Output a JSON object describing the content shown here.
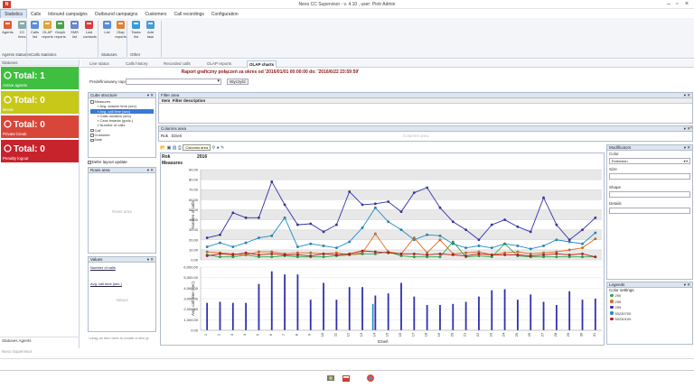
{
  "window": {
    "title": "Nexo CC Supervisor - v. 4.10 , user: Piotr Admin"
  },
  "menu": [
    "Statistics",
    "Calls",
    "Inbound campaigns",
    "Outbound campaigns",
    "Customers",
    "Call recordings",
    "Configuration"
  ],
  "ribbon": {
    "buttons": [
      {
        "label": "Agents",
        "icon": "agents-icon"
      },
      {
        "label": "CC lines",
        "icon": "cc-lines-icon"
      },
      {
        "label": "Calls list",
        "icon": "calls-list-icon"
      },
      {
        "label": "OLAP reports",
        "icon": "olap-reports-icon"
      },
      {
        "label": "Graph reports",
        "icon": "graph-reports-icon"
      },
      {
        "label": "SMS list",
        "icon": "sms-list-icon"
      },
      {
        "label": "Lost contacts",
        "icon": "lost-contacts-icon"
      },
      {
        "label": "List",
        "icon": "list-icon"
      },
      {
        "label": "Olap reports",
        "icon": "olap-reports-2-icon"
      },
      {
        "label": "Tasks list",
        "icon": "tasks-list-icon"
      },
      {
        "label": "Add task",
        "icon": "add-task-icon"
      }
    ],
    "groups": [
      "Agents statuses",
      "Calls statistics",
      "Statuses",
      "Other"
    ]
  },
  "left": {
    "header": "Statuses",
    "tiles": [
      {
        "value": "Total: 1",
        "name": "Active agents",
        "color": "#3fbf3f"
      },
      {
        "value": "Total: 0",
        "name": "Break",
        "color": "#c8c819"
      },
      {
        "value": "Total: 0",
        "name": "Private break",
        "color": "#d8463a"
      },
      {
        "value": "Total: 0",
        "name": "Penalty logout",
        "color": "#c7232d"
      }
    ],
    "bottom_tabs": "Statuses  Agents",
    "footer": "Nexo Supervisor"
  },
  "tabs": [
    "Line status",
    "Calls history",
    "Recorded calls",
    "OLAP reports",
    "OLAP charts"
  ],
  "report": {
    "title": "Raport graficzny połączeń za okres od '2016/01/01 00:00:00 do: '2016/6/22 23:59:59'",
    "predefined_label": "Predefiniowany raport:",
    "clear_button": "Wyczyść"
  },
  "cube": {
    "header": "Cube structure",
    "measures_label": "Measures",
    "items": [
      "Avg. answer time (sec)",
      "Avg. call time (sec)",
      "Calls duration (sec)",
      "Czas trwania (godz.)",
      "Number of calls"
    ],
    "groups": [
      "Call",
      "Customer",
      "Date"
    ]
  },
  "defer_label": "Defer layout update",
  "rows_area": {
    "header": "Rows area",
    "placeholder": "Rows area"
  },
  "values_area": {
    "header": "Values",
    "fields": [
      "Number of calls",
      "Avg. call time (sec.)"
    ],
    "sub": "Values"
  },
  "filter_area": {
    "header": "Filter area",
    "col_item": "Item",
    "col_desc": "Filter description"
  },
  "columns_area": {
    "header": "Columns area",
    "fields": [
      "Rok",
      "Dzień"
    ],
    "placeholder": "Columns area"
  },
  "chart_toolbar": {
    "tooltip": "Columns area"
  },
  "chart_header": {
    "rok": "Rok",
    "year": "2016",
    "measures": "Measures"
  },
  "chart_data": {
    "type": "line",
    "x": [
      1,
      2,
      3,
      4,
      5,
      6,
      7,
      8,
      9,
      10,
      11,
      12,
      13,
      14,
      15,
      16,
      17,
      18,
      19,
      20,
      21,
      22,
      23,
      24,
      25,
      26,
      27,
      28,
      29,
      30,
      31
    ],
    "xlabel": "Dzień",
    "top_panel": {
      "ylabel": "Number of calls",
      "ylim": [
        0,
        90
      ],
      "yticks": [
        "0.00",
        "10.00",
        "20.00",
        "30.00",
        "40.00",
        "50.00",
        "60.00",
        "70.00",
        "80.00",
        "90.00"
      ],
      "series": [
        {
          "color": "#3030b0",
          "values": [
            22,
            25,
            47,
            42,
            42,
            78,
            55,
            35,
            36,
            28,
            35,
            68,
            55,
            56,
            58,
            48,
            67,
            72,
            52,
            38,
            30,
            20,
            35,
            40,
            33,
            28,
            62,
            35,
            20,
            30,
            42
          ]
        },
        {
          "color": "#1c8ec4",
          "values": [
            13,
            17,
            13,
            17,
            22,
            24,
            42,
            13,
            16,
            14,
            12,
            18,
            32,
            52,
            38,
            30,
            20,
            25,
            24,
            16,
            12,
            14,
            12,
            16,
            14,
            11,
            14,
            20,
            18,
            16,
            27
          ]
        },
        {
          "color": "#28a745",
          "values": [
            5,
            3,
            3,
            5,
            3,
            3,
            4,
            3,
            3,
            3,
            4,
            5,
            6,
            6,
            8,
            4,
            3,
            3,
            3,
            18,
            3,
            4,
            3,
            16,
            4,
            3,
            3,
            3,
            3,
            3,
            3
          ]
        },
        {
          "color": "#e36b17",
          "values": [
            8,
            7,
            6,
            5,
            8,
            8,
            6,
            7,
            7,
            6,
            7,
            5,
            7,
            26,
            8,
            6,
            22,
            7,
            20,
            6,
            7,
            8,
            5,
            7,
            8,
            6,
            7,
            8,
            10,
            12,
            21
          ]
        },
        {
          "color": "#c01818",
          "values": [
            4,
            6,
            5,
            7,
            5,
            6,
            5,
            5,
            4,
            6,
            5,
            6,
            9,
            8,
            7,
            6,
            6,
            5,
            6,
            5,
            4,
            6,
            5,
            5,
            5,
            4,
            5,
            6,
            5,
            6,
            3
          ]
        }
      ]
    },
    "bottom_panel": {
      "ylabel": "Avg. call time (sec)",
      "ylim": [
        0,
        6000
      ],
      "yticks": [
        "0.00",
        "1,000.00",
        "2,000.00",
        "3,000.00",
        "4,000.00",
        "5,000.00",
        "6,000.00"
      ],
      "bars": [
        2600,
        2700,
        2600,
        2600,
        4400,
        5600,
        5300,
        5300,
        2900,
        4500,
        2900,
        4100,
        4100,
        3300,
        3500,
        4500,
        3200,
        2400,
        2400,
        2500,
        2700,
        3200,
        3800,
        3900,
        2900,
        3400,
        2700,
        2400,
        3700,
        2900,
        3000
      ],
      "bars2": [
        0,
        0,
        0,
        0,
        0,
        0,
        0,
        0,
        0,
        0,
        0,
        0,
        0,
        2500,
        0,
        0,
        0,
        0,
        0,
        0,
        0,
        0,
        0,
        0,
        0,
        0,
        0,
        0,
        0,
        0,
        0
      ],
      "bars2_color": "#1c8ec4",
      "bars3": [
        0,
        0,
        0,
        0,
        0,
        0,
        0,
        0,
        0,
        0,
        0,
        0,
        0,
        0,
        0,
        0,
        0,
        0,
        0,
        0,
        0,
        0,
        0,
        0,
        0,
        0,
        0,
        0,
        0,
        0,
        0
      ],
      "bar_color": "#3030b0"
    }
  },
  "modificators": {
    "header": "Modificators",
    "color_label": "Color",
    "color_value": "Extension",
    "size_label": "Size",
    "shape_label": "Shape",
    "details_label": "Details"
  },
  "legends": {
    "header": "Legends",
    "settings": "Color settings",
    "items": [
      {
        "label": "290",
        "color": "#28a745"
      },
      {
        "label": "295",
        "color": "#e36b17"
      },
      {
        "label": "299",
        "color": "#3030b0"
      },
      {
        "label": "50230700",
        "color": "#1c8ec4"
      },
      {
        "label": "50230100",
        "color": "#c01818"
      }
    ]
  },
  "drag_hint": "<drag an item here to create a new gr"
}
